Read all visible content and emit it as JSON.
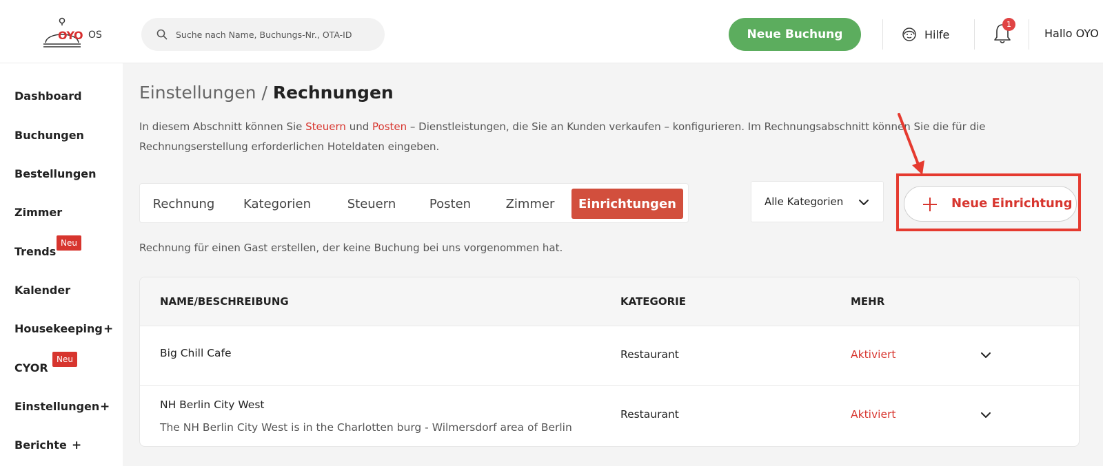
{
  "header": {
    "logo_text": "OYO",
    "logo_suffix": "OS",
    "search_placeholder": "Suche nach Name, Buchungs-Nr., OTA-ID",
    "new_booking_label": "Neue Buchung",
    "help_label": "Hilfe",
    "notification_count": "1",
    "greeting": "Hallo OYO"
  },
  "sidebar": {
    "items": [
      {
        "label": "Dashboard"
      },
      {
        "label": "Buchungen"
      },
      {
        "label": "Bestellungen"
      },
      {
        "label": "Zimmer"
      },
      {
        "label": "Trends",
        "badge": "Neu"
      },
      {
        "label": "Kalender"
      },
      {
        "label": "Housekeeping",
        "expand": "+"
      },
      {
        "label": "CYOR",
        "badge": "Neu"
      },
      {
        "label": "Einstellungen",
        "expand": "+"
      },
      {
        "label": "Berichte",
        "expand": "+"
      }
    ]
  },
  "main": {
    "breadcrumb_parent": "Einstellungen",
    "breadcrumb_sep": "/",
    "breadcrumb_current": "Rechnungen",
    "desc_part1": "In diesem Abschnitt können Sie ",
    "desc_link1": "Steuern",
    "desc_part2": " und ",
    "desc_link2": "Posten",
    "desc_part3": " – Dienstleistungen, die Sie an Kunden verkaufen – konfigurieren. Im Rechnungsabschnitt können Sie die für die Rechnungserstellung erforderlichen Hoteldaten eingeben.",
    "tabs": [
      {
        "label": "Rechnung"
      },
      {
        "label": "Kategorien"
      },
      {
        "label": "Steuern"
      },
      {
        "label": "Posten"
      },
      {
        "label": "Zimmer"
      },
      {
        "label": "Einrichtungen",
        "active": true
      }
    ],
    "category_filter": "Alle Kategorien",
    "new_facility_label": "Neue Einrichtung",
    "note": "Rechnung für einen Gast erstellen, der keine Buchung bei uns vorgenommen hat.",
    "table": {
      "columns": [
        "NAME/BESCHREIBUNG",
        "KATEGORIE",
        "MEHR"
      ],
      "rows": [
        {
          "name": "Big Chill Cafe",
          "description": "",
          "category": "Restaurant",
          "status": "Aktiviert"
        },
        {
          "name": "NH Berlin City West",
          "description": "The NH Berlin City West is in the Charlotten burg - Wilmersdorf area of Berlin",
          "category": "Restaurant",
          "status": "Aktiviert"
        }
      ]
    }
  },
  "colors": {
    "brand_red": "#d7352e",
    "green": "#5cad5e",
    "annotation_red": "#e53a2f"
  }
}
